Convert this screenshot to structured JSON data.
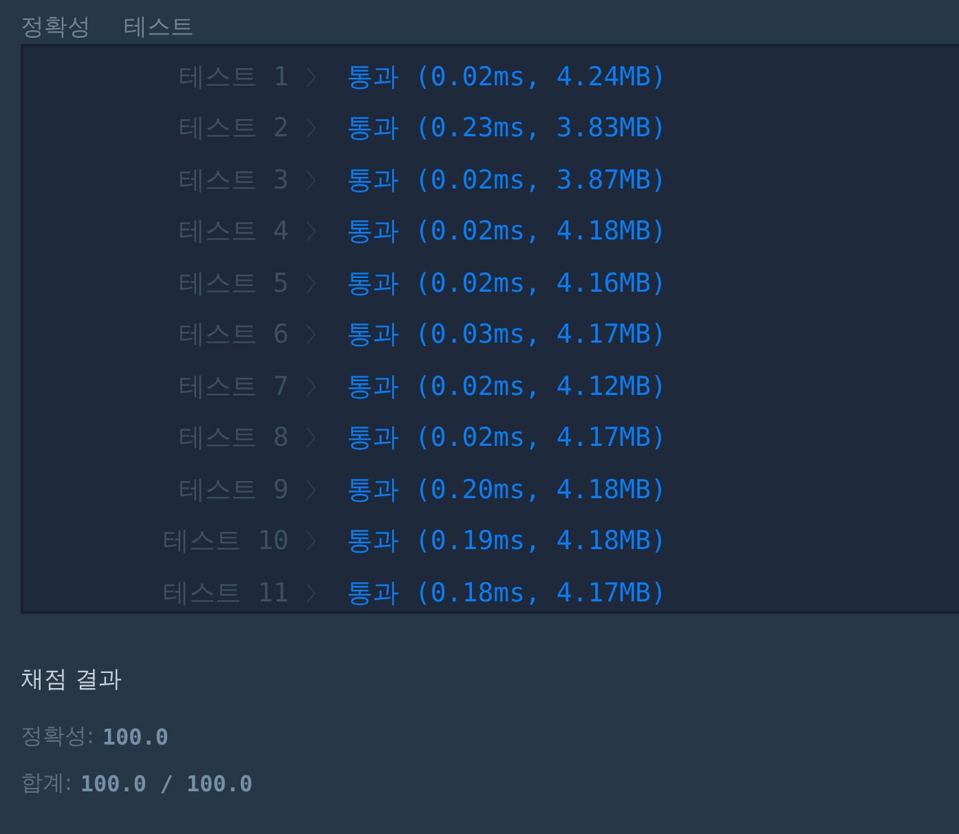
{
  "header": {
    "title": "정확성",
    "subtitle": "테스트"
  },
  "tests": [
    {
      "label": "테스트 1",
      "result": "통과 (0.02ms, 4.24MB)"
    },
    {
      "label": "테스트 2",
      "result": "통과 (0.23ms, 3.83MB)"
    },
    {
      "label": "테스트 3",
      "result": "통과 (0.02ms, 3.87MB)"
    },
    {
      "label": "테스트 4",
      "result": "통과 (0.02ms, 4.18MB)"
    },
    {
      "label": "테스트 5",
      "result": "통과 (0.02ms, 4.16MB)"
    },
    {
      "label": "테스트 6",
      "result": "통과 (0.03ms, 4.17MB)"
    },
    {
      "label": "테스트 7",
      "result": "통과 (0.02ms, 4.12MB)"
    },
    {
      "label": "테스트 8",
      "result": "통과 (0.02ms, 4.17MB)"
    },
    {
      "label": "테스트 9",
      "result": "통과 (0.20ms, 4.18MB)"
    },
    {
      "label": "테스트 10",
      "result": "통과 (0.19ms, 4.18MB)"
    },
    {
      "label": "테스트 11",
      "result": "통과 (0.18ms, 4.17MB)"
    }
  ],
  "summary": {
    "title": "채점 결과",
    "lines": [
      {
        "label": "정확성:",
        "value": "100.0"
      },
      {
        "label": "합계:",
        "value": "100.0 / 100.0"
      }
    ]
  }
}
